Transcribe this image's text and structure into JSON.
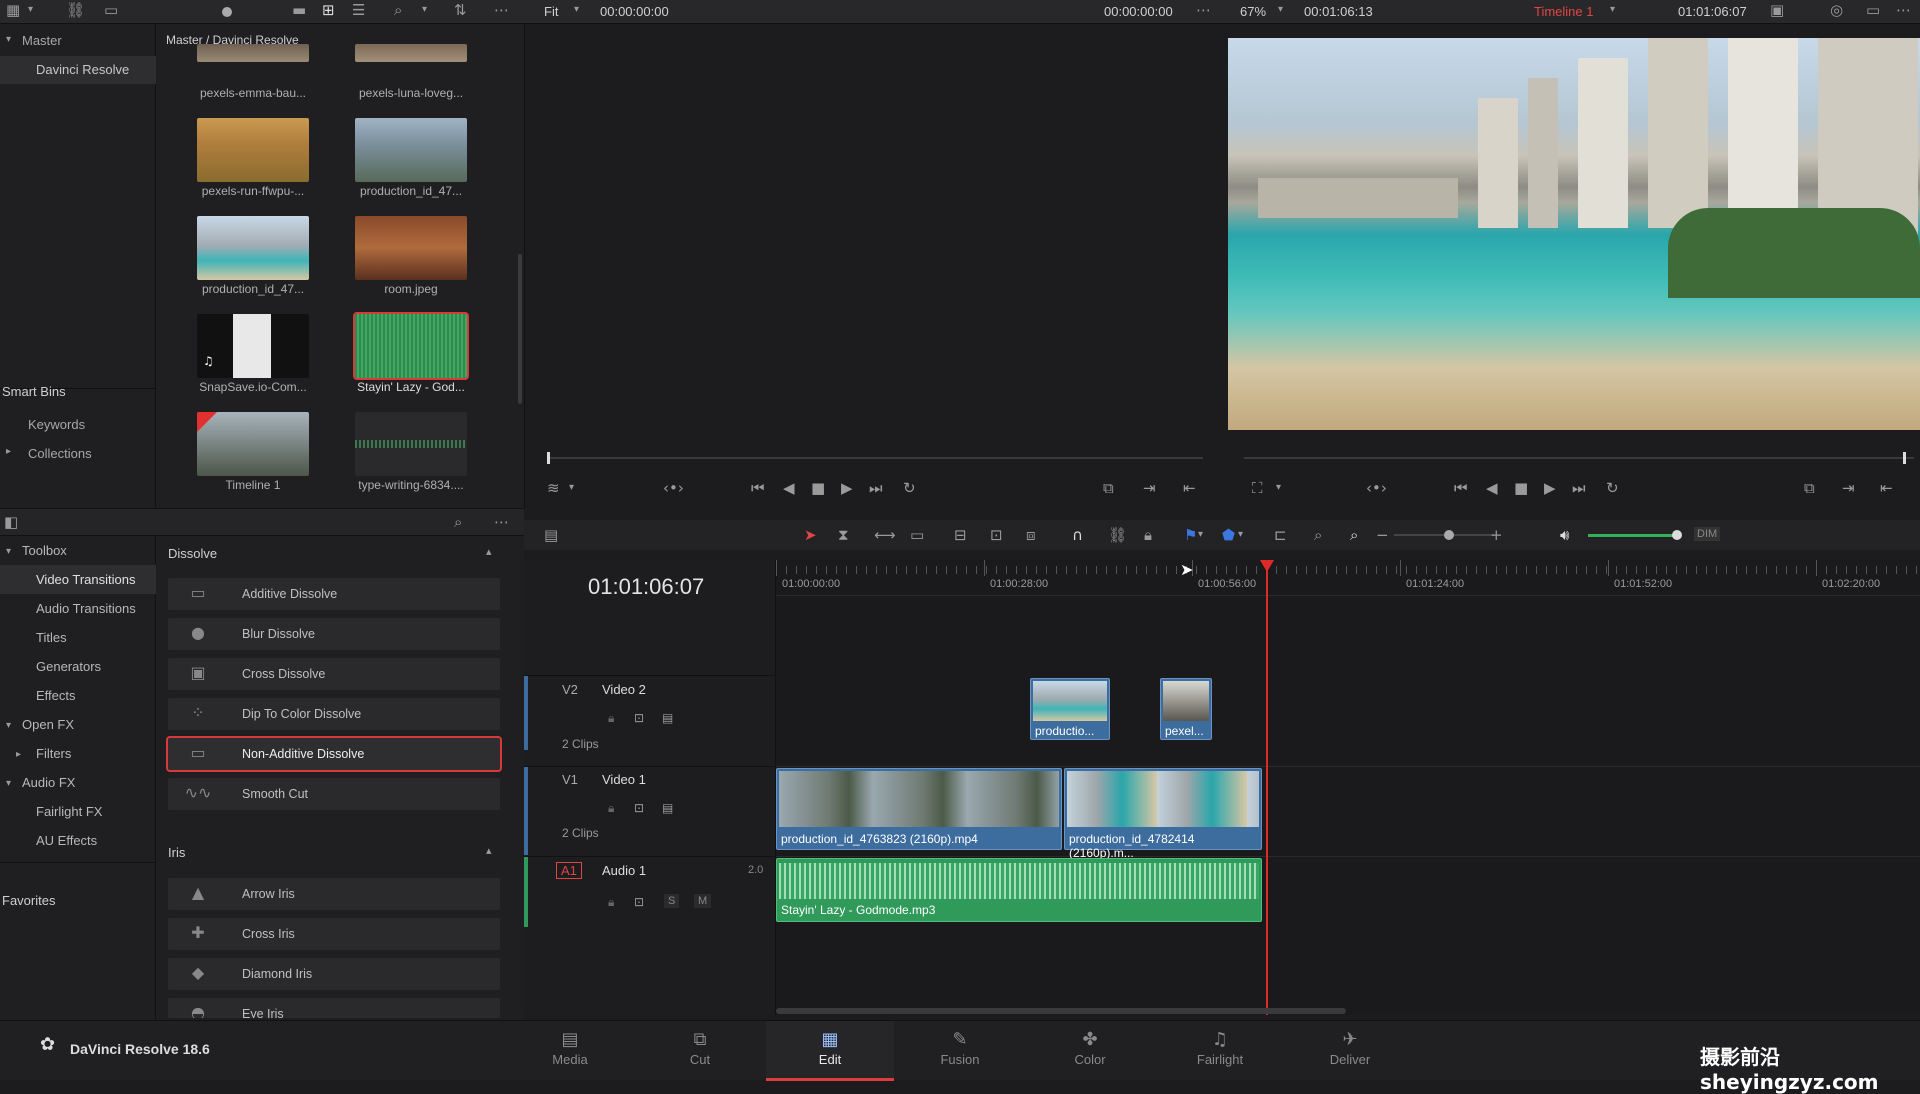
{
  "topbar": {
    "source_fit": "Fit",
    "source_tc": "00:00:00:00",
    "program_tc_left": "00:00:00:00",
    "zoom": "67%",
    "duration": "00:01:06:13",
    "timeline_name": "Timeline 1",
    "program_tc": "01:01:06:07"
  },
  "bins": {
    "master": "Master",
    "davinci": "Davinci Resolve",
    "smart_bins": "Smart Bins",
    "keywords": "Keywords",
    "collections": "Collections",
    "favorites": "Favorites"
  },
  "media": {
    "breadcrumb": "Master / Davinci Resolve",
    "items": [
      {
        "label": "pexels-emma-bau..."
      },
      {
        "label": "pexels-luna-loveg..."
      },
      {
        "label": "pexels-run-ffwpu-..."
      },
      {
        "label": "production_id_47..."
      },
      {
        "label": "production_id_47..."
      },
      {
        "label": "room.jpeg"
      },
      {
        "label": "SnapSave.io-Com..."
      },
      {
        "label": "Stayin' Lazy - God..."
      },
      {
        "label": "Timeline 1"
      },
      {
        "label": "type-writing-6834...."
      }
    ]
  },
  "toolbox": {
    "cats": [
      "Toolbox",
      "Video Transitions",
      "Audio Transitions",
      "Titles",
      "Generators",
      "Effects",
      "Open FX",
      "Filters",
      "Audio FX",
      "Fairlight FX",
      "AU Effects"
    ],
    "dissolve_header": "Dissolve",
    "dissolves": [
      "Additive Dissolve",
      "Blur Dissolve",
      "Cross Dissolve",
      "Dip To Color Dissolve",
      "Non-Additive Dissolve",
      "Smooth Cut"
    ],
    "iris_header": "Iris",
    "iris": [
      "Arrow Iris",
      "Cross Iris",
      "Diamond Iris",
      "Eye Iris"
    ]
  },
  "timeline": {
    "timecode": "01:01:06:07",
    "ruler": [
      "01:00:00:00",
      "01:00:28:00",
      "01:00:56:00",
      "01:01:24:00",
      "01:01:52:00",
      "01:02:20:00"
    ],
    "tracks": {
      "v2": {
        "id": "V2",
        "name": "Video 2",
        "clips": "2 Clips"
      },
      "v1": {
        "id": "V1",
        "name": "Video 1",
        "clips": "2 Clips"
      },
      "a1": {
        "id": "A1",
        "name": "Audio 1",
        "ch": "2.0",
        "s": "S",
        "m": "M"
      }
    },
    "v2_clip1": "productio...",
    "v2_clip2": "pexel...",
    "v1_clip1": "production_id_4763823 (2160p).mp4",
    "v1_clip2": "production_id_4782414 (2160p).m...",
    "a1_clip": "Stayin' Lazy - Godmode.mp3",
    "dim": "DIM"
  },
  "pages": [
    {
      "label": "Media",
      "icon": "media-page-icon"
    },
    {
      "label": "Cut",
      "icon": "cut-page-icon"
    },
    {
      "label": "Edit",
      "icon": "edit-page-icon"
    },
    {
      "label": "Fusion",
      "icon": "fusion-page-icon"
    },
    {
      "label": "Color",
      "icon": "color-page-icon"
    },
    {
      "label": "Fairlight",
      "icon": "fairlight-page-icon"
    },
    {
      "label": "Deliver",
      "icon": "deliver-page-icon"
    }
  ],
  "app": {
    "name": "DaVinci Resolve 18.6",
    "watermark": "摄影前沿 sheyingzyz.com"
  },
  "colors": {
    "accent_red": "#e03c3c",
    "video_clip": "#3d6c9e",
    "audio_clip": "#2f9a5a",
    "playhead": "#e02a2a"
  }
}
